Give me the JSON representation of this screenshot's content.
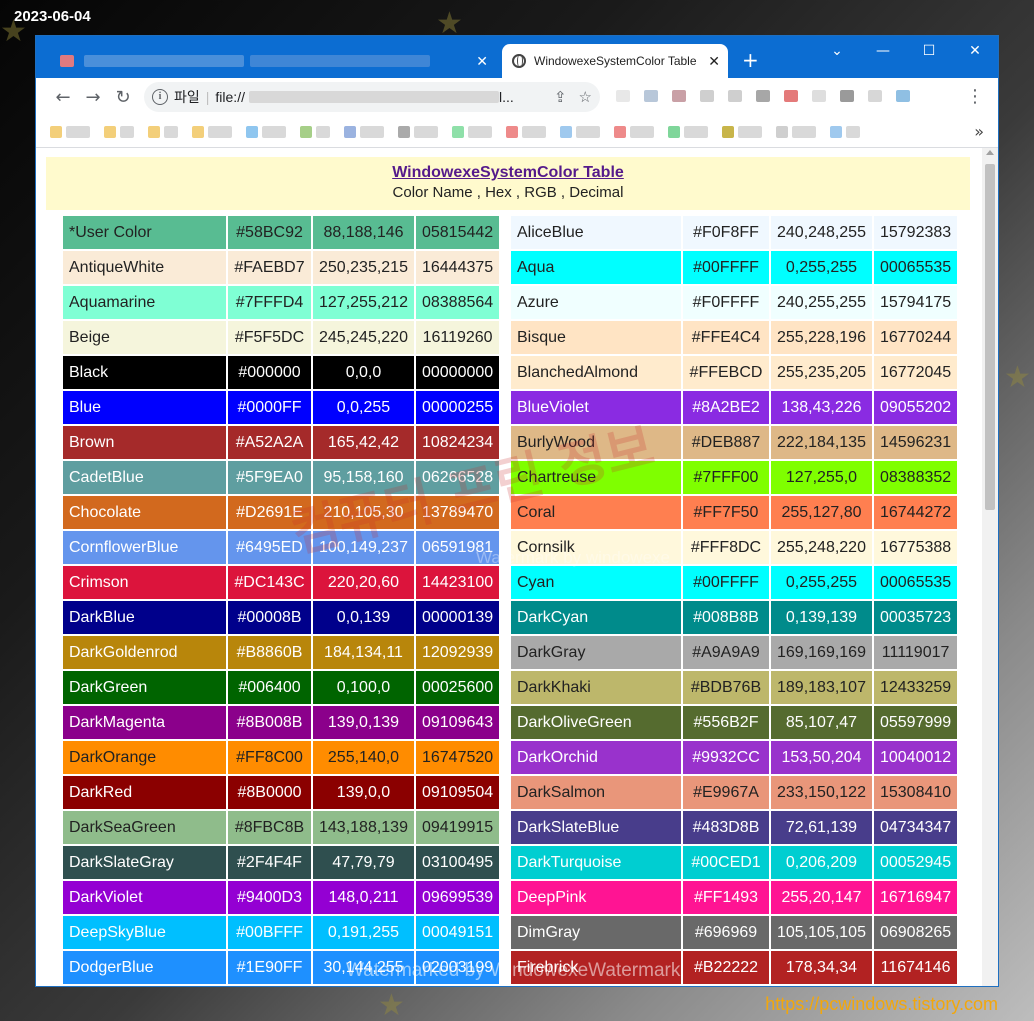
{
  "stamp": {
    "date": "2023-06-04",
    "site": "https://pcwindows.tistory.com"
  },
  "browser": {
    "active_tab_title": "WindowexeSystemColor Table",
    "address_label": "파일",
    "address_url": "file://",
    "address_ellipsis": "l...",
    "colors": {
      "tabstrip": "#0c6dd2",
      "omnibox": "#f1f3f4"
    }
  },
  "page": {
    "title": "WindowexeSystemColor Table",
    "subtitle": "Color Name , Hex , RGB , Decimal"
  },
  "left_colors": [
    {
      "name": "*User Color",
      "hex": "#58BC92",
      "rgb": "88,188,146",
      "dec": "05815442"
    },
    {
      "name": "AntiqueWhite",
      "hex": "#FAEBD7",
      "rgb": "250,235,215",
      "dec": "16444375"
    },
    {
      "name": "Aquamarine",
      "hex": "#7FFFD4",
      "rgb": "127,255,212",
      "dec": "08388564"
    },
    {
      "name": "Beige",
      "hex": "#F5F5DC",
      "rgb": "245,245,220",
      "dec": "16119260"
    },
    {
      "name": "Black",
      "hex": "#000000",
      "rgb": "0,0,0",
      "dec": "00000000"
    },
    {
      "name": "Blue",
      "hex": "#0000FF",
      "rgb": "0,0,255",
      "dec": "00000255"
    },
    {
      "name": "Brown",
      "hex": "#A52A2A",
      "rgb": "165,42,42",
      "dec": "10824234"
    },
    {
      "name": "CadetBlue",
      "hex": "#5F9EA0",
      "rgb": "95,158,160",
      "dec": "06266528"
    },
    {
      "name": "Chocolate",
      "hex": "#D2691E",
      "rgb": "210,105,30",
      "dec": "13789470"
    },
    {
      "name": "CornflowerBlue",
      "hex": "#6495ED",
      "rgb": "100,149,237",
      "dec": "06591981"
    },
    {
      "name": "Crimson",
      "hex": "#DC143C",
      "rgb": "220,20,60",
      "dec": "14423100"
    },
    {
      "name": "DarkBlue",
      "hex": "#00008B",
      "rgb": "0,0,139",
      "dec": "00000139"
    },
    {
      "name": "DarkGoldenrod",
      "hex": "#B8860B",
      "rgb": "184,134,11",
      "dec": "12092939"
    },
    {
      "name": "DarkGreen",
      "hex": "#006400",
      "rgb": "0,100,0",
      "dec": "00025600"
    },
    {
      "name": "DarkMagenta",
      "hex": "#8B008B",
      "rgb": "139,0,139",
      "dec": "09109643"
    },
    {
      "name": "DarkOrange",
      "hex": "#FF8C00",
      "rgb": "255,140,0",
      "dec": "16747520"
    },
    {
      "name": "DarkRed",
      "hex": "#8B0000",
      "rgb": "139,0,0",
      "dec": "09109504"
    },
    {
      "name": "DarkSeaGreen",
      "hex": "#8FBC8B",
      "rgb": "143,188,139",
      "dec": "09419915"
    },
    {
      "name": "DarkSlateGray",
      "hex": "#2F4F4F",
      "rgb": "47,79,79",
      "dec": "03100495"
    },
    {
      "name": "DarkViolet",
      "hex": "#9400D3",
      "rgb": "148,0,211",
      "dec": "09699539"
    },
    {
      "name": "DeepSkyBlue",
      "hex": "#00BFFF",
      "rgb": "0,191,255",
      "dec": "00049151"
    },
    {
      "name": "DodgerBlue",
      "hex": "#1E90FF",
      "rgb": "30,144,255",
      "dec": "02003199"
    }
  ],
  "right_colors": [
    {
      "name": "AliceBlue",
      "hex": "#F0F8FF",
      "rgb": "240,248,255",
      "dec": "15792383"
    },
    {
      "name": "Aqua",
      "hex": "#00FFFF",
      "rgb": "0,255,255",
      "dec": "00065535"
    },
    {
      "name": "Azure",
      "hex": "#F0FFFF",
      "rgb": "240,255,255",
      "dec": "15794175"
    },
    {
      "name": "Bisque",
      "hex": "#FFE4C4",
      "rgb": "255,228,196",
      "dec": "16770244"
    },
    {
      "name": "BlanchedAlmond",
      "hex": "#FFEBCD",
      "rgb": "255,235,205",
      "dec": "16772045"
    },
    {
      "name": "BlueViolet",
      "hex": "#8A2BE2",
      "rgb": "138,43,226",
      "dec": "09055202"
    },
    {
      "name": "BurlyWood",
      "hex": "#DEB887",
      "rgb": "222,184,135",
      "dec": "14596231"
    },
    {
      "name": "Chartreuse",
      "hex": "#7FFF00",
      "rgb": "127,255,0",
      "dec": "08388352"
    },
    {
      "name": "Coral",
      "hex": "#FF7F50",
      "rgb": "255,127,80",
      "dec": "16744272"
    },
    {
      "name": "Cornsilk",
      "hex": "#FFF8DC",
      "rgb": "255,248,220",
      "dec": "16775388"
    },
    {
      "name": "Cyan",
      "hex": "#00FFFF",
      "rgb": "0,255,255",
      "dec": "00065535"
    },
    {
      "name": "DarkCyan",
      "hex": "#008B8B",
      "rgb": "0,139,139",
      "dec": "00035723"
    },
    {
      "name": "DarkGray",
      "hex": "#A9A9A9",
      "rgb": "169,169,169",
      "dec": "11119017"
    },
    {
      "name": "DarkKhaki",
      "hex": "#BDB76B",
      "rgb": "189,183,107",
      "dec": "12433259"
    },
    {
      "name": "DarkOliveGreen",
      "hex": "#556B2F",
      "rgb": "85,107,47",
      "dec": "05597999"
    },
    {
      "name": "DarkOrchid",
      "hex": "#9932CC",
      "rgb": "153,50,204",
      "dec": "10040012"
    },
    {
      "name": "DarkSalmon",
      "hex": "#E9967A",
      "rgb": "233,150,122",
      "dec": "15308410"
    },
    {
      "name": "DarkSlateBlue",
      "hex": "#483D8B",
      "rgb": "72,61,139",
      "dec": "04734347"
    },
    {
      "name": "DarkTurquoise",
      "hex": "#00CED1",
      "rgb": "0,206,209",
      "dec": "00052945"
    },
    {
      "name": "DeepPink",
      "hex": "#FF1493",
      "rgb": "255,20,147",
      "dec": "16716947"
    },
    {
      "name": "DimGray",
      "hex": "#696969",
      "rgb": "105,105,105",
      "dec": "06908265"
    },
    {
      "name": "Firebrick",
      "hex": "#B22222",
      "rgb": "178,34,34",
      "dec": "11674146"
    }
  ],
  "watermarks": {
    "center_korean": "컴퓨터 프린 정보",
    "center_text": "Watermark by windowexe",
    "bottom_text": "Watermarked by WindowexeWatermark"
  },
  "icons": {
    "back": "back-arrow-icon",
    "forward": "forward-arrow-icon",
    "reload": "reload-icon",
    "info": "info-icon",
    "share": "share-icon",
    "bookmark": "bookmark-star-icon",
    "menu": "more-vert-icon",
    "close": "close-icon",
    "new_tab": "plus-icon"
  }
}
